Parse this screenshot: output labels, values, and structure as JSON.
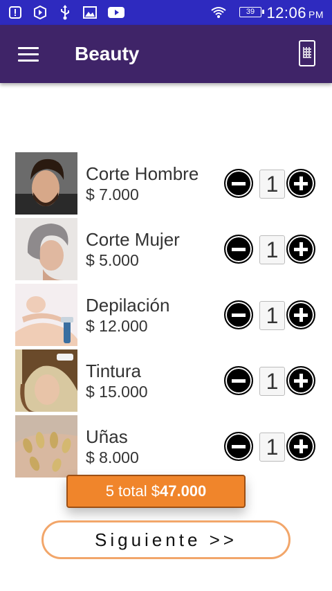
{
  "status_bar": {
    "battery": "39",
    "time": "12:06",
    "ampm": "PM",
    "icons": [
      "alert-icon",
      "shield-play-icon",
      "usb-icon",
      "image-icon",
      "youtube-icon",
      "wifi-icon"
    ]
  },
  "app_bar": {
    "title": "Beauty",
    "menu_icon": "hamburger-icon",
    "action_icon": "phone-qr-icon",
    "background": "#3f2468"
  },
  "services": [
    {
      "name": "Corte Hombre",
      "price": "$ 7.000",
      "qty": "1",
      "image": "man-haircut-photo"
    },
    {
      "name": "Corte Mujer",
      "price": "$ 5.000",
      "qty": "1",
      "image": "woman-haircut-photo"
    },
    {
      "name": "Depilación",
      "price": "$ 12.000",
      "qty": "1",
      "image": "waxing-photo"
    },
    {
      "name": "Tintura",
      "price": "$ 15.000",
      "qty": "1",
      "image": "hair-dye-photo"
    },
    {
      "name": "Uñas",
      "price": "$ 8.000",
      "qty": "1",
      "image": "nails-photo"
    }
  ],
  "total": {
    "prefix": "5 total $",
    "amount": "47.000",
    "color": "#f0852b"
  },
  "next_button": {
    "label": "Siguiente >>",
    "border_color": "#f2a66a"
  }
}
